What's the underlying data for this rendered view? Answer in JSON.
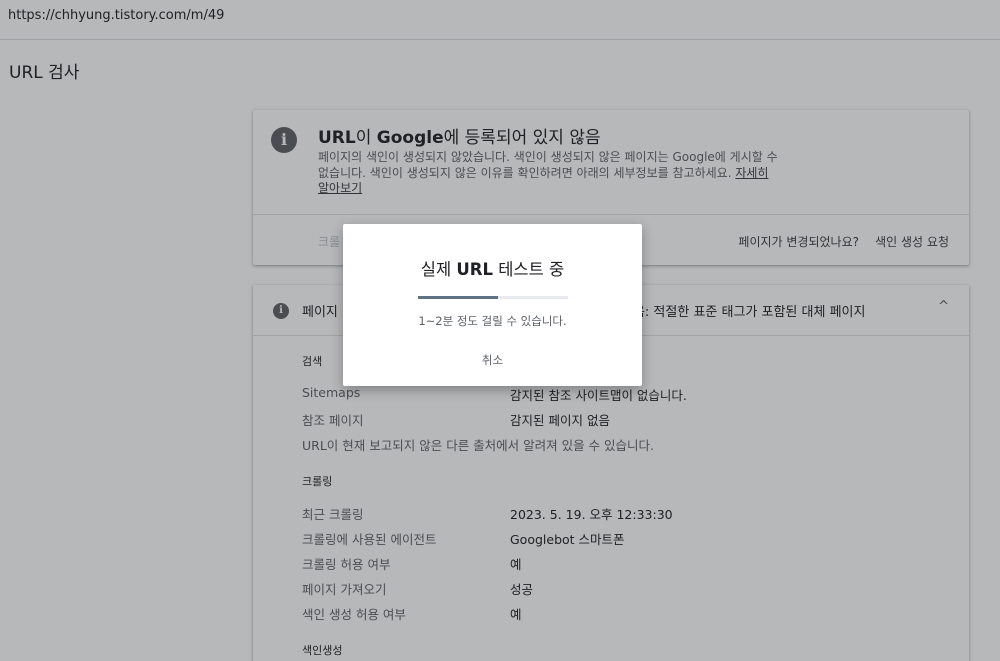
{
  "browser": {
    "url": "https://chhyung.tistory.com/m/49"
  },
  "page": {
    "title": "URL 검사"
  },
  "status_card": {
    "title_part1": "URL",
    "title_part2": "이 ",
    "title_part3": "Google",
    "title_part4": "에 등록되어 있지 않음",
    "description": "페이지의 색인이 생성되지 않았습니다. 색인이 생성되지 않은 페이지는 Google에 게시할 수 없습니다. 색인이 생성되지 않은 이유를 확인하려면 아래의 세부정보를 참고하세요. ",
    "learn_more": "자세히 알아보기",
    "crawl_button_partial": "크롤",
    "changed_question": "페이지가 변경되었나요?",
    "request_indexing": "색인 생성 요청"
  },
  "detail_card": {
    "header_left": "페이지",
    "header_right": "않음: 적절한 표준 태그가 포함된 대체 페이지",
    "discovery": {
      "label": "검색",
      "rows": [
        {
          "label": "Sitemaps",
          "value": "감지된 참조 사이트맵이 없습니다."
        },
        {
          "label": "참조 페이지",
          "value": "감지된 페이지 없음"
        }
      ],
      "note": "URL이 현재 보고되지 않은 다른 출처에서 알려져 있을 수 있습니다."
    },
    "crawl": {
      "label": "크롤링",
      "rows": [
        {
          "label": "최근 크롤링",
          "value": "2023. 5. 19. 오후 12:33:30"
        },
        {
          "label": "크롤링에 사용된 에이전트",
          "value": "Googlebot 스마트폰"
        },
        {
          "label": "크롤링 허용 여부",
          "value": "예"
        },
        {
          "label": "페이지 가져오기",
          "value": "성공"
        },
        {
          "label": "색인 생성 허용 여부",
          "value": "예"
        }
      ]
    },
    "indexing": {
      "label": "색인생성"
    }
  },
  "dialog": {
    "title_part1": "실제 ",
    "title_part2": "URL",
    "title_part3": " 테스트 중",
    "progress_fraction": 0.53,
    "subtitle": "1~2분 정도 걸릴 수 있습니다.",
    "cancel": "취소"
  }
}
